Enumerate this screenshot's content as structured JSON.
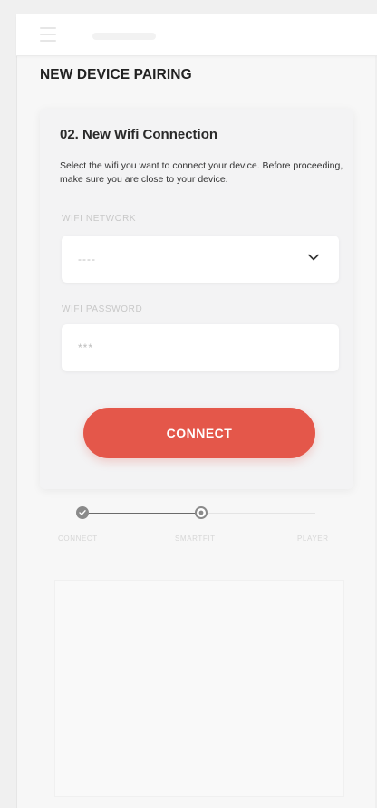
{
  "header": {
    "title": "NEW DEVICE PAIRING"
  },
  "step": {
    "title": "02. New Wifi Connection",
    "description": "Select the wifi you want to connect your device. Before proceeding, make sure you are close to your device."
  },
  "wifi_network": {
    "label": "WIFI NETWORK",
    "value": "----"
  },
  "wifi_password": {
    "label": "WIFI PASSWORD",
    "value": "***"
  },
  "connect_button": {
    "label": "CONNECT"
  },
  "stepper": {
    "steps": [
      {
        "label": "CONNECT",
        "state": "done"
      },
      {
        "label": "SMARTFIT",
        "state": "current"
      },
      {
        "label": "PLAYER",
        "state": "pending"
      }
    ]
  },
  "colors": {
    "accent": "#e4574a",
    "step_active": "#8a8a8a"
  }
}
